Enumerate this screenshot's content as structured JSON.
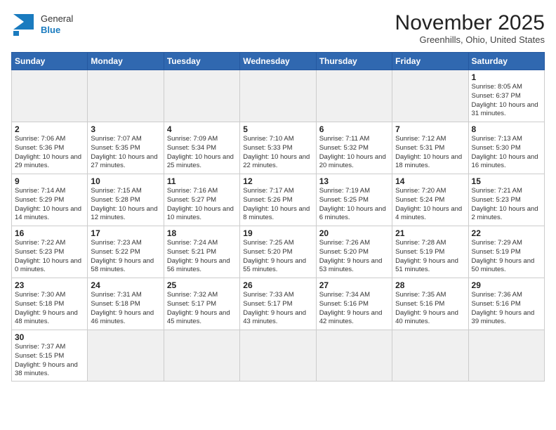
{
  "header": {
    "logo_general": "General",
    "logo_blue": "Blue",
    "month_title": "November 2025",
    "location": "Greenhills, Ohio, United States"
  },
  "days_of_week": [
    "Sunday",
    "Monday",
    "Tuesday",
    "Wednesday",
    "Thursday",
    "Friday",
    "Saturday"
  ],
  "weeks": [
    [
      {
        "day": null,
        "info": null
      },
      {
        "day": null,
        "info": null
      },
      {
        "day": null,
        "info": null
      },
      {
        "day": null,
        "info": null
      },
      {
        "day": null,
        "info": null
      },
      {
        "day": null,
        "info": null
      },
      {
        "day": "1",
        "info": "Sunrise: 8:05 AM\nSunset: 6:37 PM\nDaylight: 10 hours and 31 minutes."
      }
    ],
    [
      {
        "day": "2",
        "info": "Sunrise: 7:06 AM\nSunset: 5:36 PM\nDaylight: 10 hours and 29 minutes."
      },
      {
        "day": "3",
        "info": "Sunrise: 7:07 AM\nSunset: 5:35 PM\nDaylight: 10 hours and 27 minutes."
      },
      {
        "day": "4",
        "info": "Sunrise: 7:09 AM\nSunset: 5:34 PM\nDaylight: 10 hours and 25 minutes."
      },
      {
        "day": "5",
        "info": "Sunrise: 7:10 AM\nSunset: 5:33 PM\nDaylight: 10 hours and 22 minutes."
      },
      {
        "day": "6",
        "info": "Sunrise: 7:11 AM\nSunset: 5:32 PM\nDaylight: 10 hours and 20 minutes."
      },
      {
        "day": "7",
        "info": "Sunrise: 7:12 AM\nSunset: 5:31 PM\nDaylight: 10 hours and 18 minutes."
      },
      {
        "day": "8",
        "info": "Sunrise: 7:13 AM\nSunset: 5:30 PM\nDaylight: 10 hours and 16 minutes."
      }
    ],
    [
      {
        "day": "9",
        "info": "Sunrise: 7:14 AM\nSunset: 5:29 PM\nDaylight: 10 hours and 14 minutes."
      },
      {
        "day": "10",
        "info": "Sunrise: 7:15 AM\nSunset: 5:28 PM\nDaylight: 10 hours and 12 minutes."
      },
      {
        "day": "11",
        "info": "Sunrise: 7:16 AM\nSunset: 5:27 PM\nDaylight: 10 hours and 10 minutes."
      },
      {
        "day": "12",
        "info": "Sunrise: 7:17 AM\nSunset: 5:26 PM\nDaylight: 10 hours and 8 minutes."
      },
      {
        "day": "13",
        "info": "Sunrise: 7:19 AM\nSunset: 5:25 PM\nDaylight: 10 hours and 6 minutes."
      },
      {
        "day": "14",
        "info": "Sunrise: 7:20 AM\nSunset: 5:24 PM\nDaylight: 10 hours and 4 minutes."
      },
      {
        "day": "15",
        "info": "Sunrise: 7:21 AM\nSunset: 5:23 PM\nDaylight: 10 hours and 2 minutes."
      }
    ],
    [
      {
        "day": "16",
        "info": "Sunrise: 7:22 AM\nSunset: 5:23 PM\nDaylight: 10 hours and 0 minutes."
      },
      {
        "day": "17",
        "info": "Sunrise: 7:23 AM\nSunset: 5:22 PM\nDaylight: 9 hours and 58 minutes."
      },
      {
        "day": "18",
        "info": "Sunrise: 7:24 AM\nSunset: 5:21 PM\nDaylight: 9 hours and 56 minutes."
      },
      {
        "day": "19",
        "info": "Sunrise: 7:25 AM\nSunset: 5:20 PM\nDaylight: 9 hours and 55 minutes."
      },
      {
        "day": "20",
        "info": "Sunrise: 7:26 AM\nSunset: 5:20 PM\nDaylight: 9 hours and 53 minutes."
      },
      {
        "day": "21",
        "info": "Sunrise: 7:28 AM\nSunset: 5:19 PM\nDaylight: 9 hours and 51 minutes."
      },
      {
        "day": "22",
        "info": "Sunrise: 7:29 AM\nSunset: 5:19 PM\nDaylight: 9 hours and 50 minutes."
      }
    ],
    [
      {
        "day": "23",
        "info": "Sunrise: 7:30 AM\nSunset: 5:18 PM\nDaylight: 9 hours and 48 minutes."
      },
      {
        "day": "24",
        "info": "Sunrise: 7:31 AM\nSunset: 5:18 PM\nDaylight: 9 hours and 46 minutes."
      },
      {
        "day": "25",
        "info": "Sunrise: 7:32 AM\nSunset: 5:17 PM\nDaylight: 9 hours and 45 minutes."
      },
      {
        "day": "26",
        "info": "Sunrise: 7:33 AM\nSunset: 5:17 PM\nDaylight: 9 hours and 43 minutes."
      },
      {
        "day": "27",
        "info": "Sunrise: 7:34 AM\nSunset: 5:16 PM\nDaylight: 9 hours and 42 minutes."
      },
      {
        "day": "28",
        "info": "Sunrise: 7:35 AM\nSunset: 5:16 PM\nDaylight: 9 hours and 40 minutes."
      },
      {
        "day": "29",
        "info": "Sunrise: 7:36 AM\nSunset: 5:16 PM\nDaylight: 9 hours and 39 minutes."
      }
    ],
    [
      {
        "day": "30",
        "info": "Sunrise: 7:37 AM\nSunset: 5:15 PM\nDaylight: 9 hours and 38 minutes."
      },
      {
        "day": null,
        "info": null
      },
      {
        "day": null,
        "info": null
      },
      {
        "day": null,
        "info": null
      },
      {
        "day": null,
        "info": null
      },
      {
        "day": null,
        "info": null
      },
      {
        "day": null,
        "info": null
      }
    ]
  ]
}
